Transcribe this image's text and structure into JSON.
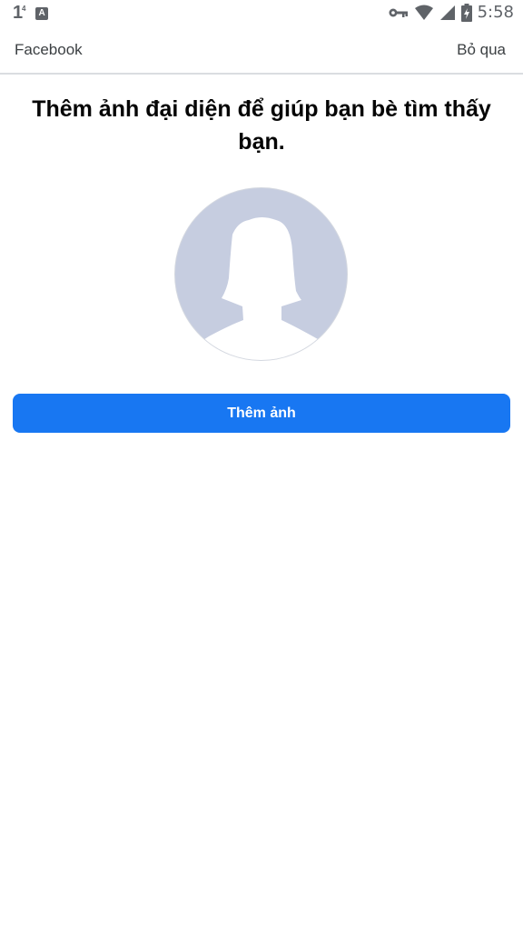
{
  "status_bar": {
    "notification_number": "1",
    "notification_superscript": "4",
    "app_icon_letter": "A",
    "time": "5:58",
    "icons": [
      "key-icon",
      "wifi-icon",
      "signal-icon",
      "battery-icon"
    ]
  },
  "header": {
    "title": "Facebook",
    "skip_label": "Bỏ qua"
  },
  "main": {
    "headline": "Thêm ảnh đại diện để giúp bạn bè tìm thấy bạn.",
    "avatar_icon": "default-profile-avatar",
    "add_photo_label": "Thêm ảnh"
  },
  "colors": {
    "primary_button": "#1877f2",
    "avatar_background": "#c6cde0",
    "divider": "#dadde1"
  }
}
